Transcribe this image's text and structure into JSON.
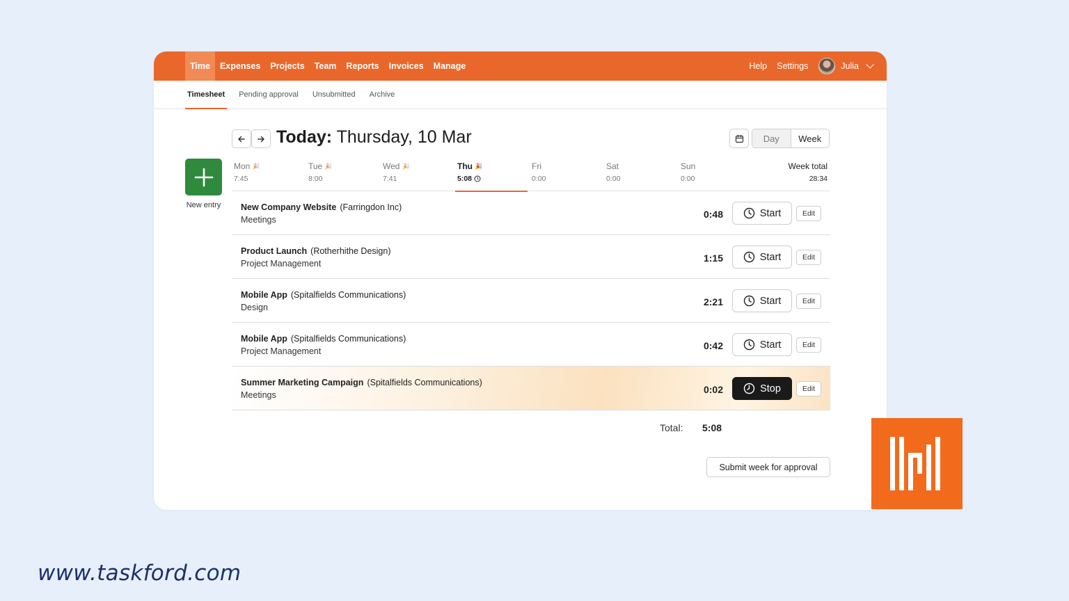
{
  "topnav": {
    "items": [
      {
        "label": "Time",
        "active": true
      },
      {
        "label": "Expenses"
      },
      {
        "label": "Projects"
      },
      {
        "label": "Team"
      },
      {
        "label": "Reports"
      },
      {
        "label": "Invoices"
      },
      {
        "label": "Manage"
      }
    ],
    "help": "Help",
    "settings": "Settings",
    "user": "Julia"
  },
  "subnav": {
    "items": [
      {
        "label": "Timesheet",
        "active": true
      },
      {
        "label": "Pending approval"
      },
      {
        "label": "Unsubmitted"
      },
      {
        "label": "Archive"
      }
    ]
  },
  "header": {
    "today_prefix": "Today:",
    "date": "Thursday, 10 Mar",
    "view_day": "Day",
    "view_week": "Week"
  },
  "new_entry": {
    "label": "New entry"
  },
  "days": [
    {
      "name": "Mon",
      "value": "7:45"
    },
    {
      "name": "Tue",
      "value": "8:00"
    },
    {
      "name": "Wed",
      "value": "7:41"
    },
    {
      "name": "Thu",
      "value": "5:08"
    },
    {
      "name": "Fri",
      "value": "0:00"
    },
    {
      "name": "Sat",
      "value": "0:00"
    },
    {
      "name": "Sun",
      "value": "0:00"
    }
  ],
  "week_total": {
    "label": "Week total",
    "value": "28:34"
  },
  "entries": [
    {
      "project": "New Company Website",
      "client": "(Farringdon Inc)",
      "task": "Meetings",
      "duration": "0:48",
      "action": "Start",
      "edit": "Edit"
    },
    {
      "project": "Product Launch",
      "client": "(Rotherhithe Design)",
      "task": "Project Management",
      "duration": "1:15",
      "action": "Start",
      "edit": "Edit"
    },
    {
      "project": "Mobile App",
      "client": "(Spitalfields Communications)",
      "task": "Design",
      "duration": "2:21",
      "action": "Start",
      "edit": "Edit"
    },
    {
      "project": "Mobile App",
      "client": "(Spitalfields Communications)",
      "task": "Project Management",
      "duration": "0:42",
      "action": "Start",
      "edit": "Edit"
    },
    {
      "project": "Summer Marketing Campaign",
      "client": "(Spitalfields Communications)",
      "task": "Meetings",
      "duration": "0:02",
      "action": "Stop",
      "edit": "Edit"
    }
  ],
  "total": {
    "label": "Total:",
    "value": "5:08"
  },
  "submit": {
    "label": "Submit week for approval"
  },
  "footer": {
    "url": "www.taskford.com"
  },
  "colors": {
    "brand": "#e9672b",
    "new_entry": "#2f8a3d",
    "logo": "#f26a1b",
    "footer_text": "#1c2f6d"
  },
  "icons": {
    "prev": "arrow-left-icon",
    "next": "arrow-right-icon",
    "calendar": "calendar-icon",
    "timer": "clock-icon",
    "today_marker": "party-icon"
  }
}
